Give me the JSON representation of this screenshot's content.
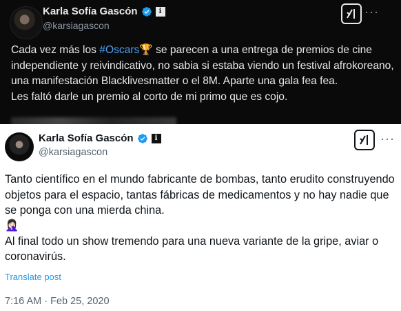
{
  "top_tweet": {
    "author_name": "Karla Sofía Gascón",
    "handle": "@karsiagascon",
    "label_badge": "i",
    "text_before_hashtag": "Cada vez más los ",
    "hashtag": "#Oscars",
    "text_after_hashtag": " se parecen a una entrega de premios de cine independiente y reivindicativo, no sabia si estaba viendo un festival afrokoreano, una manifestación Blacklivesmatter o el 8M. Aparte una gala fea fea.",
    "text_line_2": "Les faltó darle un premio al corto de mi primo que es cojo.",
    "oscar_emoji": "🏆",
    "icons": {
      "verified": "verified-badge-icon",
      "grok": "grok-icon",
      "more": "more-options-icon"
    },
    "colors": {
      "background": "#0a0a0a",
      "hashtag": "#4a9eed",
      "verified": "#1d9bf0"
    }
  },
  "bottom_tweet": {
    "author_name": "Karla Sofía Gascón",
    "handle": "@karsiagascon",
    "label_badge": "i",
    "paragraph_1": "Tanto científico en el mundo fabricante de bombas, tanto erudito construyendo objetos para el espacio, tantas fábricas de medicamentos y no hay nadie que se ponga con una mierda china.",
    "emoji": "🤦🏻‍♀️",
    "paragraph_2": "Al final todo un show tremendo para una nueva variante de la gripe, aviar o coronavirús.",
    "translate_link": "Translate post",
    "timestamp": "7:16 AM · Feb 25, 2020",
    "icons": {
      "verified": "verified-badge-icon",
      "grok": "grok-icon",
      "more": "more-options-icon"
    },
    "colors": {
      "background": "#ffffff",
      "link": "#1d9bf0",
      "verified": "#1d9bf0"
    }
  }
}
